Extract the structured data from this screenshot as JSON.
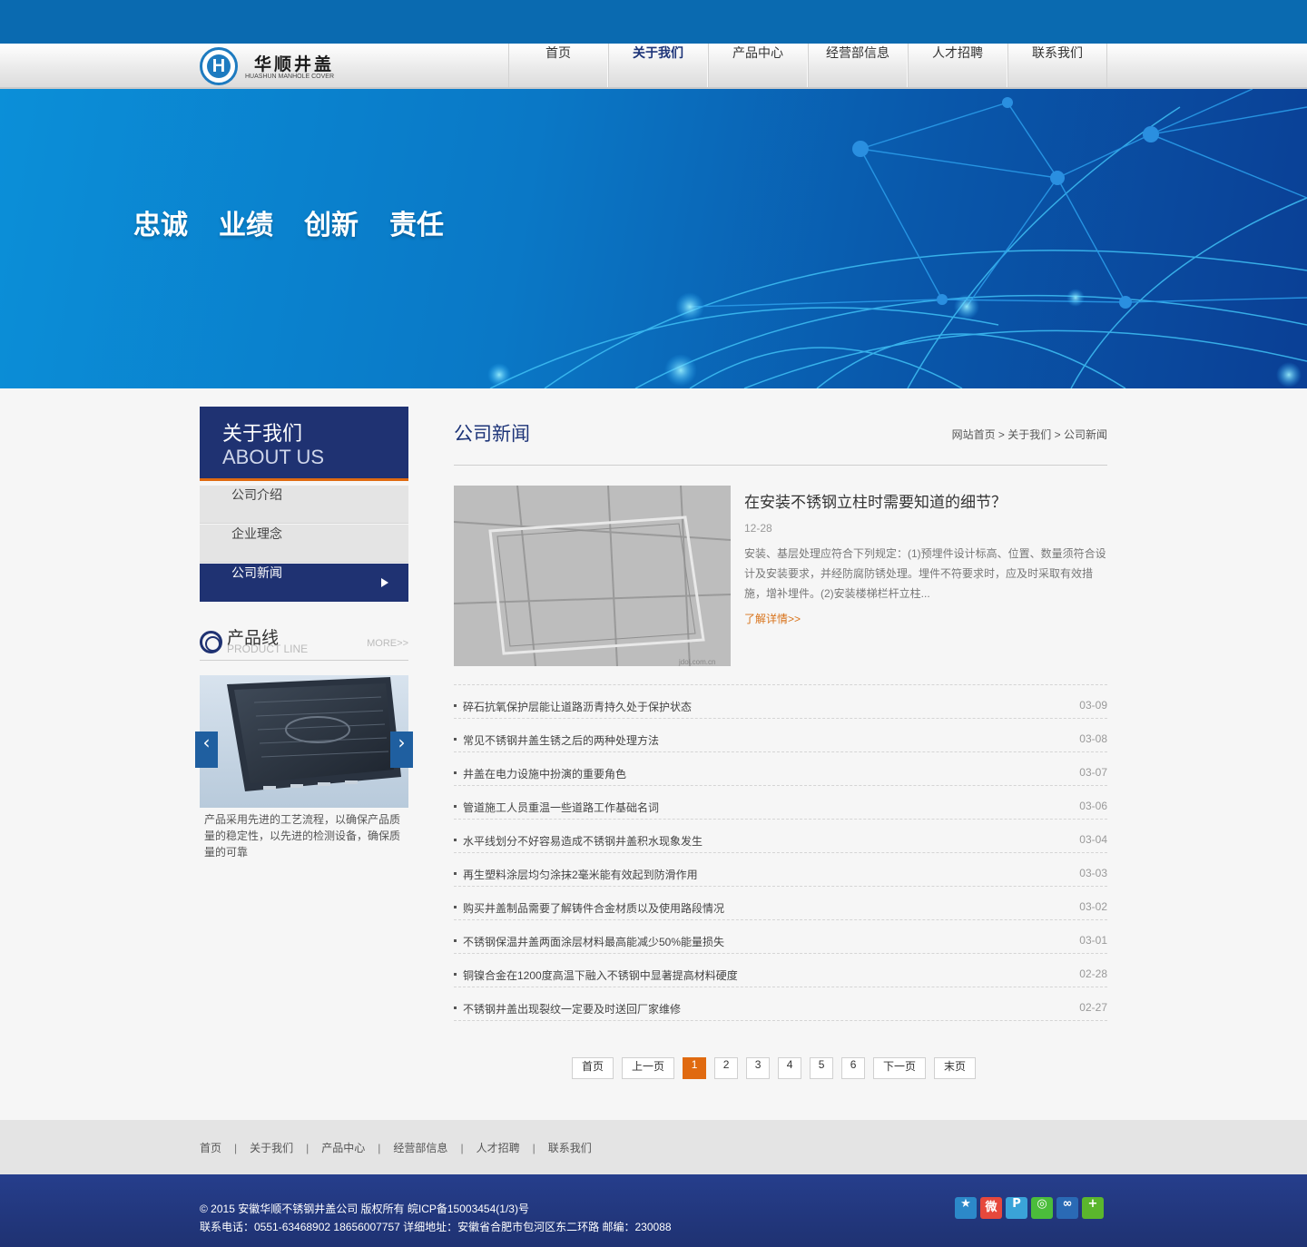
{
  "logo": {
    "cn": "华顺井盖",
    "en": "HUASHUN MANHOLE COVER",
    "mark": "H"
  },
  "nav": [
    {
      "label": "首页",
      "active": false
    },
    {
      "label": "关于我们",
      "active": true
    },
    {
      "label": "产品中心",
      "active": false
    },
    {
      "label": "经营部信息",
      "active": false
    },
    {
      "label": "人才招聘",
      "active": false
    },
    {
      "label": "联系我们",
      "active": false
    }
  ],
  "banner": {
    "slogan": [
      "忠诚",
      "业绩",
      "创新",
      "责任"
    ]
  },
  "sidebar": {
    "title_cn": "关于我们",
    "title_en": "ABOUT US",
    "menu": [
      {
        "label": "公司介绍",
        "active": false
      },
      {
        "label": "企业理念",
        "active": false
      },
      {
        "label": "公司新闻",
        "active": true
      }
    ],
    "product_line": {
      "title_cn": "产品线",
      "title_en": "PRODUCT LINE",
      "more": "MORE>>",
      "description": "产品采用先进的工艺流程，以确保产品质量的稳定性，以先进的检测设备，确保质量的可靠"
    }
  },
  "main": {
    "title": "公司新闻",
    "breadcrumb": [
      "网站首页",
      "关于我们",
      "公司新闻"
    ],
    "breadcrumb_sep": " > ",
    "feature": {
      "title": "在安装不锈钢立柱时需要知道的细节？",
      "date": "12-28",
      "summary": "安装、基层处理应符合下列规定：(1)预埋件设计标高、位置、数量须符合设计及安装要求，并经防腐防锈处理。埋件不符要求时，应及时采取有效措施，增补埋件。(2)安装楼梯栏杆立柱...",
      "more": "了解详情>>",
      "image_watermark": "jdol.com.cn"
    },
    "news": [
      {
        "title": "碎石抗氧保护层能让道路沥青持久处于保护状态",
        "date": "03-09"
      },
      {
        "title": "常见不锈钢井盖生锈之后的两种处理方法",
        "date": "03-08"
      },
      {
        "title": "井盖在电力设施中扮演的重要角色",
        "date": "03-07"
      },
      {
        "title": "管道施工人员重温一些道路工作基础名词",
        "date": "03-06"
      },
      {
        "title": "水平线划分不好容易造成不锈钢井盖积水现象发生",
        "date": "03-04"
      },
      {
        "title": "再生塑料涂层均匀涂抹2毫米能有效起到防滑作用",
        "date": "03-03"
      },
      {
        "title": "购买井盖制品需要了解铸件合金材质以及使用路段情况",
        "date": "03-02"
      },
      {
        "title": "不锈钢保温井盖两面涂层材料最高能减少50%能量损失",
        "date": "03-01"
      },
      {
        "title": "铜镍合金在1200度高温下融入不锈钢中显著提高材料硬度",
        "date": "02-28"
      },
      {
        "title": "不锈钢井盖出现裂纹一定要及时送回厂家维修",
        "date": "02-27"
      }
    ],
    "pager": {
      "first": "首页",
      "prev": "上一页",
      "pages": [
        "1",
        "2",
        "3",
        "4",
        "5",
        "6"
      ],
      "current": "1",
      "next": "下一页",
      "last": "末页"
    }
  },
  "footer": {
    "nav": [
      "首页",
      "关于我们",
      "产品中心",
      "经营部信息",
      "人才招聘",
      "联系我们"
    ],
    "nav_sep": "|",
    "copyright": "© 2015 安徽华顺不锈钢井盖公司 版权所有 皖ICP备15003454(1/3)号",
    "contact": "联系电话：0551-63468902 18656007757 详细地址：安徽省合肥市包河区东二环路 邮编：230088",
    "share": [
      {
        "icon": "qzone-icon",
        "color": "#2c89c9",
        "glyph": "★"
      },
      {
        "icon": "weibo-icon",
        "color": "#e6483c",
        "glyph": "微"
      },
      {
        "icon": "tencent-weibo-icon",
        "color": "#3aa3d8",
        "glyph": "P"
      },
      {
        "icon": "wechat-icon",
        "color": "#4bbd3b",
        "glyph": "◎"
      },
      {
        "icon": "renren-icon",
        "color": "#2a6ab5",
        "glyph": "∞"
      },
      {
        "icon": "more-share-icon",
        "color": "#5bb62d",
        "glyph": "+"
      }
    ]
  }
}
